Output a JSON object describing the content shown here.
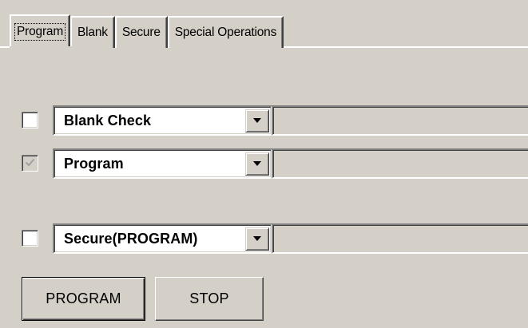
{
  "tabs": [
    {
      "label": "Program",
      "active": true
    },
    {
      "label": "Blank",
      "active": false
    },
    {
      "label": "Secure",
      "active": false
    },
    {
      "label": "Special Operations",
      "active": false
    }
  ],
  "operations": [
    {
      "checked": false,
      "enabled": true,
      "selected": "Blank Check",
      "status": ""
    },
    {
      "checked": true,
      "enabled": false,
      "selected": "Program",
      "status": ""
    },
    {
      "checked": false,
      "enabled": true,
      "selected": "Secure(PROGRAM)",
      "status": ""
    }
  ],
  "buttons": {
    "program_label": "PROGRAM",
    "stop_label": "STOP"
  },
  "colors": {
    "window_face": "#d4d0c8",
    "highlight": "#ffffff",
    "shadow": "#808080",
    "dark_shadow": "#404040",
    "disabled_check": "#a0a0a0"
  },
  "icons": {
    "dropdown": "chevron-down-icon",
    "check": "check-icon"
  }
}
